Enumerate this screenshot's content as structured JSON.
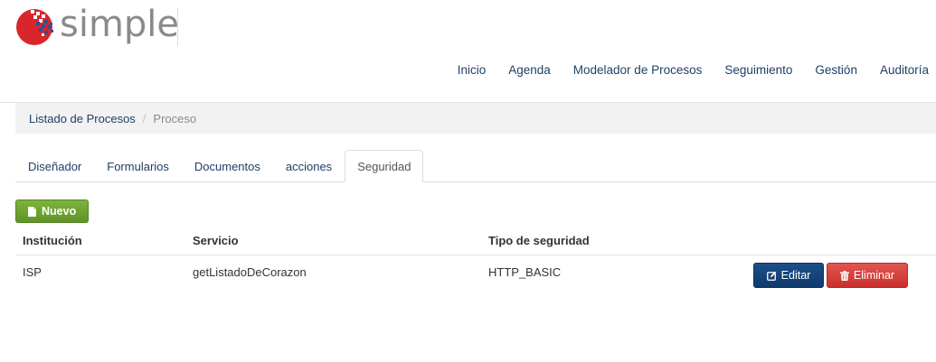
{
  "brand": {
    "name": "simple",
    "logo_color": "#d9262c"
  },
  "topnav": {
    "items": [
      "Inicio",
      "Agenda",
      "Modelador de Procesos",
      "Seguimiento",
      "Gestión",
      "Auditoría"
    ]
  },
  "breadcrumb": {
    "parent": "Listado de Procesos",
    "separator": "/",
    "current": "Proceso"
  },
  "tabs": {
    "items": [
      "Diseñador",
      "Formularios",
      "Documentos",
      "acciones",
      "Seguridad"
    ],
    "active": "Seguridad"
  },
  "toolbar": {
    "new_label": "Nuevo",
    "new_icon": "document-icon",
    "new_color": "#6ea332"
  },
  "table": {
    "headers": [
      "Institución",
      "Servicio",
      "Tipo de seguridad"
    ],
    "rows": [
      {
        "institucion": "ISP",
        "servicio": "getListadoDeCorazon",
        "tipo": "HTTP_BASIC"
      }
    ],
    "actions": {
      "edit_label": "Editar",
      "edit_icon": "edit-icon",
      "edit_color": "#15447c",
      "delete_label": "Eliminar",
      "delete_icon": "trash-icon",
      "delete_color": "#d9534f"
    }
  }
}
